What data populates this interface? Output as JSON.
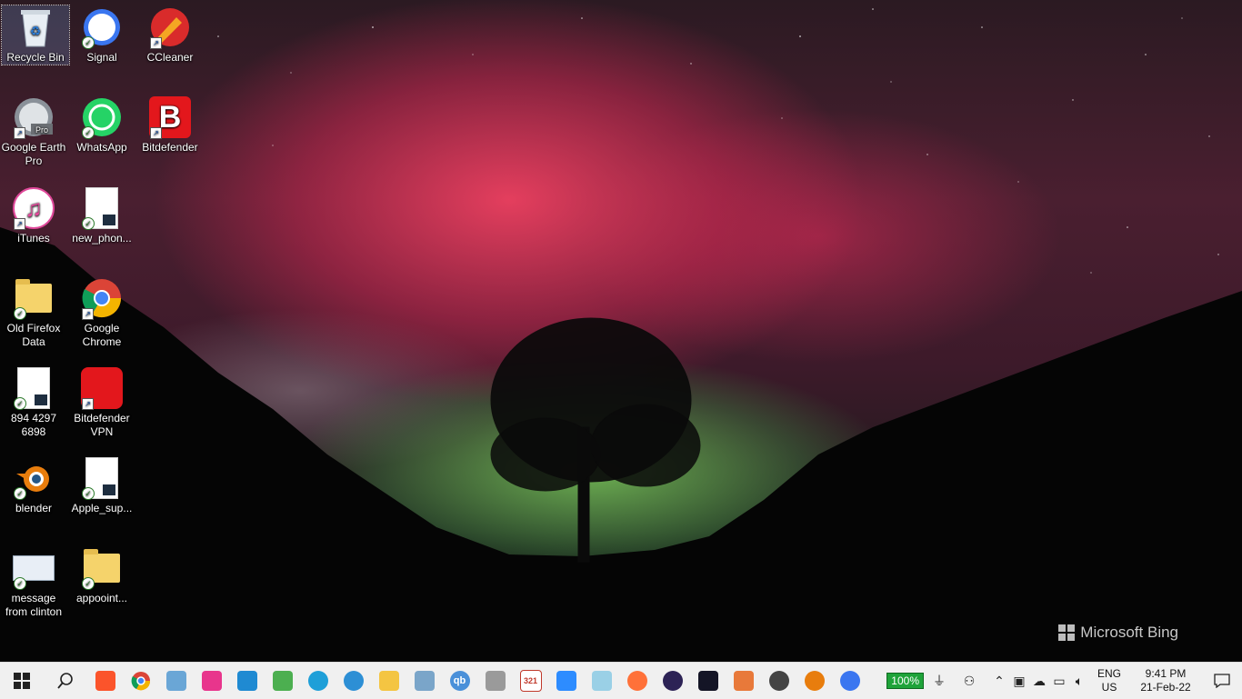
{
  "desktop": {
    "icons": [
      {
        "label": "Recycle Bin",
        "icon": "recycle-bin-icon"
      },
      {
        "label": "Signal",
        "icon": "signal-icon"
      },
      {
        "label": "CCleaner",
        "icon": "ccleaner-icon"
      },
      {
        "label": "Google Earth Pro",
        "icon": "google-earth-icon",
        "badge": "Pro"
      },
      {
        "label": "WhatsApp",
        "icon": "whatsapp-icon"
      },
      {
        "label": "Bitdefender",
        "icon": "bitdefender-icon",
        "glyph": "B"
      },
      {
        "label": "iTunes",
        "icon": "itunes-icon",
        "glyph": "♫"
      },
      {
        "label": "new_phon...",
        "icon": "document-icon"
      },
      {
        "label": "Old Firefox Data",
        "icon": "folder-icon"
      },
      {
        "label": "Google Chrome",
        "icon": "chrome-icon"
      },
      {
        "label": "894 4297 6898",
        "icon": "document-icon"
      },
      {
        "label": "Bitdefender VPN",
        "icon": "bitdefender-vpn-icon"
      },
      {
        "label": "blender",
        "icon": "blender-icon"
      },
      {
        "label": "Apple_sup...",
        "icon": "document-icon"
      },
      {
        "label": "message from clinton",
        "icon": "screenshot-file-icon"
      },
      {
        "label": "appooint...",
        "icon": "folder-icon"
      }
    ]
  },
  "wallpaper": {
    "brand": "Microsoft Bing"
  },
  "taskbar": {
    "apps": [
      {
        "name": "start-button",
        "icon": "windows-logo-icon"
      },
      {
        "name": "search-button",
        "icon": "search-icon"
      },
      {
        "name": "brave",
        "icon": "brave-icon",
        "color": "#fb542b"
      },
      {
        "name": "chrome",
        "icon": "chrome-icon",
        "color": "#4285f4"
      },
      {
        "name": "paint",
        "icon": "paint-icon",
        "color": "#6aa6d6"
      },
      {
        "name": "wps",
        "icon": "wps-icon",
        "color": "#e8358c"
      },
      {
        "name": "vscode",
        "icon": "vscode-icon",
        "color": "#1f8ad2"
      },
      {
        "name": "keepass",
        "icon": "lock-icon",
        "color": "#4caf50"
      },
      {
        "name": "edge",
        "icon": "edge-icon",
        "color": "#1e9fd8"
      },
      {
        "name": "cortana",
        "icon": "cortana-icon",
        "color": "#2d8fd5"
      },
      {
        "name": "file-explorer",
        "icon": "folder-icon",
        "color": "#f4c542"
      },
      {
        "name": "snipping",
        "icon": "snipping-icon",
        "color": "#7aa5c9"
      },
      {
        "name": "qbittorrent",
        "icon": "qbittorrent-icon",
        "color": "#4a90d9",
        "glyph": "qb"
      },
      {
        "name": "bitdefender-shield",
        "icon": "shield-icon",
        "color": "#9a9a9a"
      },
      {
        "name": "calendar",
        "icon": "calendar-icon",
        "color": "#c0392b",
        "glyph": "321"
      },
      {
        "name": "zoom",
        "icon": "zoom-icon",
        "color": "#2d8cff"
      },
      {
        "name": "notes",
        "icon": "notes-icon",
        "color": "#9ad0e6"
      },
      {
        "name": "firefox",
        "icon": "firefox-icon",
        "color": "#ff7139"
      },
      {
        "name": "eclipse",
        "icon": "eclipse-icon",
        "color": "#2c2255"
      },
      {
        "name": "speedtest",
        "icon": "speedometer-icon",
        "color": "#141526"
      },
      {
        "name": "rocket",
        "icon": "rocket-icon",
        "color": "#e8793a"
      },
      {
        "name": "yandex",
        "icon": "yandex-icon",
        "color": "#444444"
      },
      {
        "name": "blender",
        "icon": "blender-icon",
        "color": "#e87d0d"
      },
      {
        "name": "signal",
        "icon": "signal-icon",
        "color": "#3a76f0"
      }
    ],
    "battery_percent": "100%",
    "language": {
      "line1": "ENG",
      "line2": "US"
    },
    "clock": {
      "time": "9:41 PM",
      "date": "21-Feb-22"
    }
  }
}
